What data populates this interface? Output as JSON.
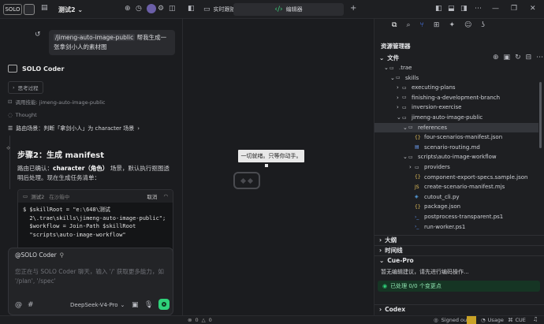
{
  "topbar": {
    "badge": "SOLO",
    "title": "测试2",
    "title_chevron": "⌄"
  },
  "chat": {
    "user_message_cmd": "/jimeng-auto-image-public",
    "user_message_text": " 帮我生成一张拿剑小人的素材图",
    "agent_name": "SOLO Coder",
    "thinking_label": "思考过程",
    "skill_call": "调用技能: jimeng-auto-image-public",
    "thought_label": "Thought",
    "route_label": "路由场景：判断「拿剑小人」为 character 场景",
    "step_title": "步骤2：生成 manifest",
    "step_desc_1": "路由已确认：",
    "step_desc_bold": "character（角色）",
    "step_desc_2": " 场景，默认执行抠图透明后处理。现在生成任务清单：",
    "code_header_left": "测试2",
    "code_header_status": "在沙箱中",
    "code_header_cancel": "取消",
    "code_lines": [
      "$ $skillRoot = \"e:\\648\\测试",
      "  2\\.trae\\skills\\jimeng-auto-image-public\";",
      "  $workflow = Join-Path $skillRoot",
      "  \"scripts\\auto-image-workflow\""
    ],
    "input_mention": "@SOLO Coder",
    "input_placeholder": "您正在与 SOLO Coder 聊天，输入 '/' 获取更多能力，如 '/plan', '/spec'",
    "model": "DeepSeek-V4-Pro"
  },
  "center": {
    "tab_realtime": "实时跟随",
    "tab_editor": "编辑器",
    "tab_add": "+",
    "toast": "一切就绪。只等你动手。"
  },
  "explorer": {
    "title": "资源管理器",
    "files_label": "文件",
    "items": [
      {
        "label": ".trae",
        "depth": 0,
        "type": "folder-open"
      },
      {
        "label": "skills",
        "depth": 1,
        "type": "folder-open"
      },
      {
        "label": "executing-plans",
        "depth": 2,
        "type": "folder"
      },
      {
        "label": "finishing-a-development-branch",
        "depth": 2,
        "type": "folder"
      },
      {
        "label": "inversion-exercise",
        "depth": 2,
        "type": "folder"
      },
      {
        "label": "jimeng-auto-image-public",
        "depth": 2,
        "type": "folder-open"
      },
      {
        "label": "references",
        "depth": 3,
        "type": "folder-open"
      },
      {
        "label": "four-scenarios-manifest.json",
        "depth": 4,
        "type": "json"
      },
      {
        "label": "scenario-routing.md",
        "depth": 4,
        "type": "md"
      },
      {
        "label": "scripts\\auto-image-workflow",
        "depth": 3,
        "type": "folder-open"
      },
      {
        "label": "providers",
        "depth": 4,
        "type": "folder"
      },
      {
        "label": "component-export-specs.sample.json",
        "depth": 4,
        "type": "json"
      },
      {
        "label": "create-scenario-manifest.mjs",
        "depth": 4,
        "type": "js"
      },
      {
        "label": "cutout_cli.py",
        "depth": 4,
        "type": "py"
      },
      {
        "label": "package.json",
        "depth": 4,
        "type": "json"
      },
      {
        "label": "postprocess-transparent.ps1",
        "depth": 4,
        "type": "ps1"
      },
      {
        "label": "run-worker.ps1",
        "depth": 4,
        "type": "ps1"
      }
    ],
    "outline_label": "大纲",
    "timeline_label": "时间线",
    "cuepro_label": "Cue-Pro",
    "cuepro_text": "暂无编辑建议，请先进行编码操作...",
    "processed_label": "已处理 0/0 个变更点",
    "codex_label": "Codex"
  },
  "status": {
    "signed_out": "Signed out",
    "usage": "Usage",
    "cue": "CUE",
    "count_0": "0",
    "count_1": "0"
  },
  "colors": {
    "accent_green": "#2fd27a",
    "accent_blue": "#4c7dff",
    "selected_row": "#34363b"
  }
}
